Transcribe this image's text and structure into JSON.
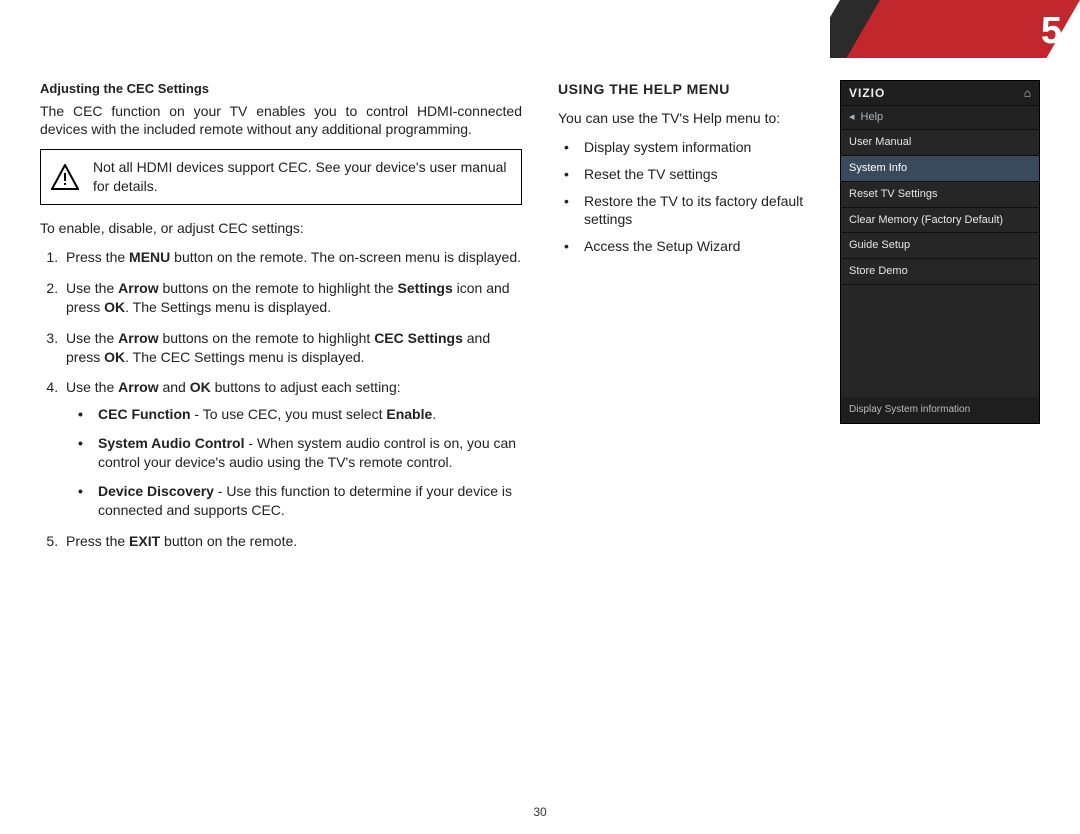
{
  "chapter_number": "5",
  "page_number": "30",
  "left": {
    "heading": "Adjusting the CEC Settings",
    "intro": "The CEC function on your TV enables you to control HDMI-connected devices with the included remote without any additional programming.",
    "callout": "Not all HDMI devices support CEC. See your device's user manual for details.",
    "lead_in": "To enable, disable, or adjust CEC settings:",
    "step1_a": "Press the ",
    "step1_b": "MENU",
    "step1_c": " button on the remote. The on-screen menu is displayed.",
    "step2_a": "Use the ",
    "step2_b": "Arrow",
    "step2_c": " buttons on the remote to highlight the ",
    "step2_d": "Settings",
    "step2_e": " icon and press ",
    "step2_f": "OK",
    "step2_g": ". The Settings menu is displayed.",
    "step3_a": "Use the ",
    "step3_b": "Arrow",
    "step3_c": " buttons on the remote to highlight ",
    "step3_d": "CEC Settings",
    "step3_e": " and press ",
    "step3_f": "OK",
    "step3_g": ". The CEC Settings menu is displayed.",
    "step4_a": "Use the ",
    "step4_b": "Arrow",
    "step4_c": " and ",
    "step4_d": "OK",
    "step4_e": " buttons to adjust each setting:",
    "sub1_b": "CEC Function",
    "sub1_t1": " - To use CEC, you must select ",
    "sub1_t2": "Enable",
    "sub1_t3": ".",
    "sub2_b": "System Audio Control",
    "sub2_t": " - When system audio control is on, you can control your device's audio using the TV's remote control.",
    "sub3_b": "Device Discovery",
    "sub3_t": " - Use this function to determine if your device is connected and supports CEC.",
    "step5_a": "Press the ",
    "step5_b": "EXIT",
    "step5_c": " button on the remote."
  },
  "right": {
    "heading": "USING THE HELP MENU",
    "intro": "You can use the TV's Help menu to:",
    "items": {
      "0": "Display system information",
      "1": "Reset the TV settings",
      "2": "Restore the TV to its factory default settings",
      "3": "Access the Setup Wizard"
    }
  },
  "menu": {
    "brand": "VIZIO",
    "home": "⌂",
    "back": "◂",
    "title": "Help",
    "items": {
      "0": "User Manual",
      "1": "System Info",
      "2": "Reset TV Settings",
      "3": "Clear Memory (Factory Default)",
      "4": "Guide Setup",
      "5": "Store Demo"
    },
    "footer": "Display System information"
  }
}
